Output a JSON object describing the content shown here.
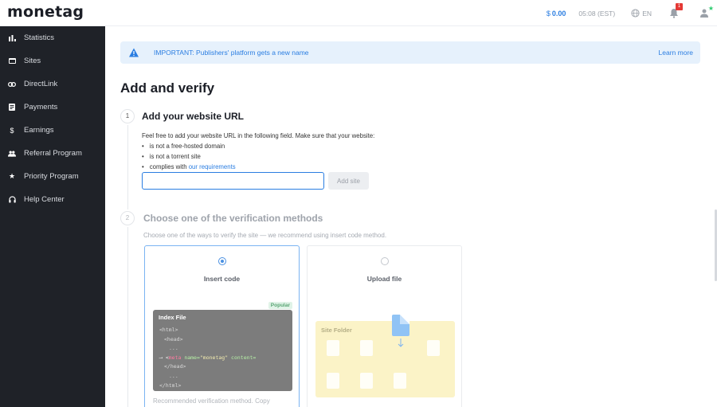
{
  "brand": {
    "logo_text": "monetag"
  },
  "topbar": {
    "currency": "$",
    "balance": "0.00",
    "time": "05:08 (EST)",
    "language": "EN",
    "notifications_count": "1",
    "accent_color": "#2a7de1"
  },
  "sidebar": {
    "items": [
      {
        "label": "Statistics",
        "icon": "bar-chart-icon"
      },
      {
        "label": "Sites",
        "icon": "window-icon"
      },
      {
        "label": "DirectLink",
        "icon": "link-icon"
      },
      {
        "label": "Payments",
        "icon": "document-icon"
      },
      {
        "label": "Earnings",
        "icon": "dollar-icon"
      },
      {
        "label": "Referral Program",
        "icon": "people-icon"
      },
      {
        "label": "Priority Program",
        "icon": "star-icon"
      },
      {
        "label": "Help Center",
        "icon": "headset-icon"
      }
    ]
  },
  "banner": {
    "message": "IMPORTANT: Publishers' platform gets a new name",
    "link": "Learn more"
  },
  "page": {
    "title": "Add and verify"
  },
  "step1": {
    "number": "1",
    "title": "Add your website URL",
    "intro": "Feel free to add your website URL in the following field. Make sure that your website:",
    "rules": [
      "is not a free-hosted domain",
      "is not a torrent site"
    ],
    "rule3_prefix": "complies with ",
    "rule3_link": "our requirements",
    "input_value": "",
    "button": "Add site"
  },
  "step2": {
    "number": "2",
    "title": "Choose one of the verification methods",
    "desc": "Choose one of the ways to verify the site — we recommend using insert code method.",
    "methods": [
      {
        "label": "Insert code",
        "selected": true,
        "folder_label": "Index File",
        "badge": "Popular",
        "code": {
          "l1": "<html>",
          "l2": "<head>",
          "l3": "...",
          "l4_arrow": "⟶ ",
          "l4_open": "<",
          "l4_tag": "meta",
          "l4_attr": " name=",
          "l4_val": "\"monetag\"",
          "l4_rest": " content=",
          "l5": "</head>",
          "l6": "...",
          "l7": "</html>"
        },
        "footer": "Recommended verification method. Copy"
      },
      {
        "label": "Upload file",
        "selected": false,
        "folder_label": "Site Folder"
      }
    ]
  }
}
